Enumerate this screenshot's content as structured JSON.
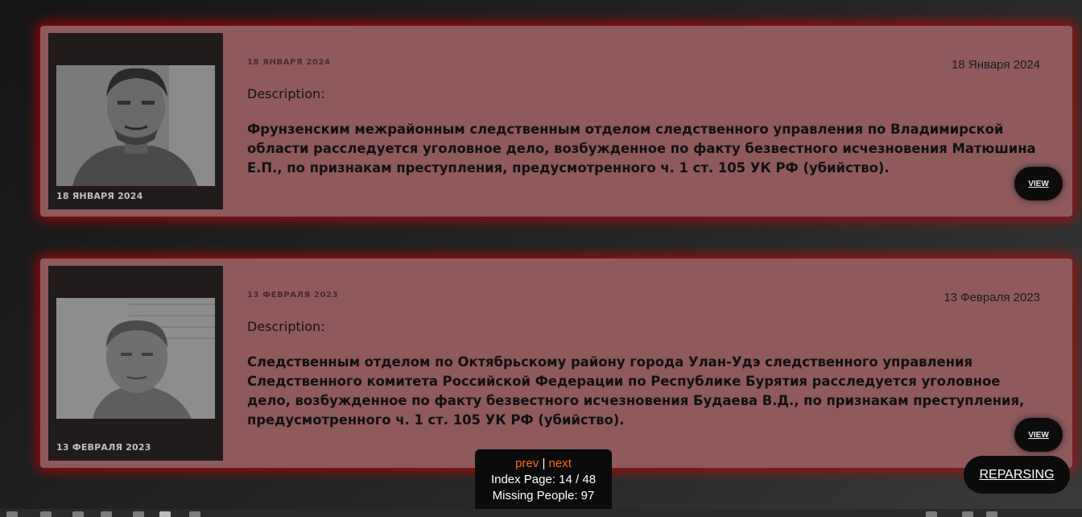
{
  "records": [
    {
      "thumb_date": "18 ЯНВАРЯ 2024",
      "small_date": "18 ЯНВАРЯ 2024",
      "date": "18 Января 2024",
      "description_label": "Description:",
      "description": "Фрунзенским межрайонным следственным отделом следственного управления по Владимирской области расследуется уголовное дело, возбужденное по факту безвестного исчезновения Матюшина Е.П., по признакам преступления, предусмотренного ч. 1 ст. 105 УК РФ (убийство).",
      "view_label": "VIEW"
    },
    {
      "thumb_date": "13 ФЕВРАЛЯ 2023",
      "small_date": "13 ФЕВРАЛЯ 2023",
      "date": "13 Февраля 2023",
      "description_label": "Description:",
      "description": "Следственным отделом по Октябрьскому району города Улан-Удэ следственного управления Следственного комитета Российской Федерации по Республике Бурятия расследуется уголовное дело, возбужденное по факту безвестного исчезновения Будаева В.Д., по признакам преступления, предусмотренного ч. 1 ст. 105 УК РФ (убийство).",
      "view_label": "VIEW"
    }
  ],
  "pager": {
    "prev": "prev",
    "separator": "|",
    "next": "next",
    "index_page": "Index Page: 14 / 48",
    "missing_people": "Missing People: 97"
  },
  "reparse_label": "REPARSING",
  "colors": {
    "card_bg": "#8e5a5c",
    "card_glow": "#cd0000",
    "link": "#ff6a1a"
  }
}
